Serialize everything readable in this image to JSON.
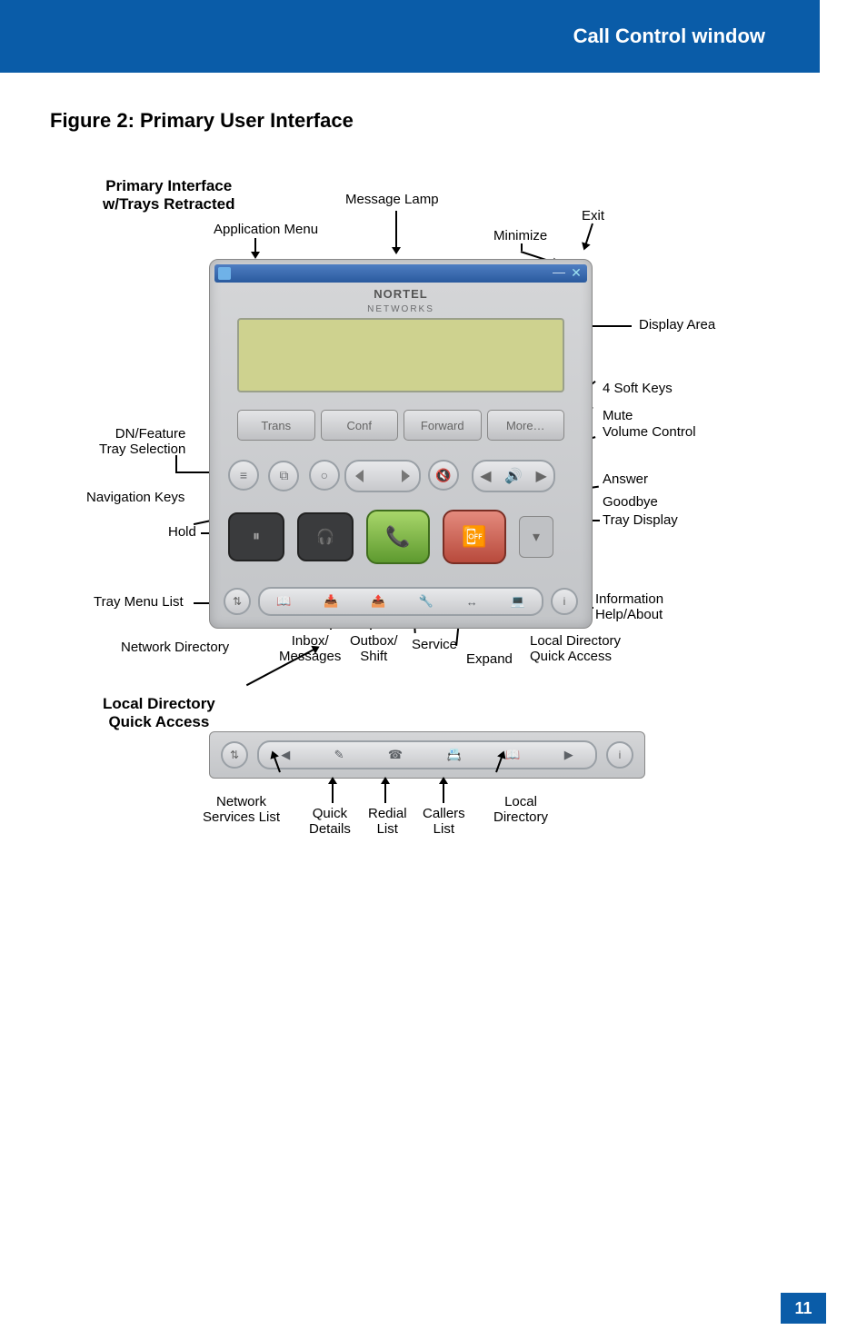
{
  "header": {
    "title": "Call Control window"
  },
  "figure": {
    "caption": "Figure 2: Primary User Interface",
    "page_number": "11"
  },
  "primary": {
    "subtitle_line1": "Primary Interface",
    "subtitle_line2": "w/Trays Retracted",
    "brand_line1": "NORTEL",
    "brand_line2": "NETWORKS",
    "softkeys": [
      "Trans",
      "Conf",
      "Forward",
      "More…"
    ],
    "titlebar_min": "—",
    "titlebar_exit": "✕",
    "callouts": {
      "msg_lamp": "Message Lamp",
      "app_menu": "Application Menu",
      "minimize": "Minimize",
      "exit": "Exit",
      "display_area": "Display Area",
      "four_soft": "4 Soft Keys",
      "mute": "Mute",
      "volume": "Volume Control",
      "dn_feature": "DN/Feature\nTray Selection",
      "nav_keys": "Navigation Keys",
      "answer": "Answer",
      "goodbye": "Goodbye",
      "hold": "Hold",
      "tray_display": "Tray Display",
      "tray_menu": "Tray Menu List",
      "info_help": "Information\nHelp/About",
      "net_dir": "Network Directory",
      "inbox": "Inbox/\nMessages",
      "outbox": "Outbox/\nShift",
      "service": "Service",
      "expand": "Expand",
      "local_dir": "Local Directory\nQuick Access"
    }
  },
  "ldqa": {
    "subtitle_line1": "Local Directory",
    "subtitle_line2": "Quick Access",
    "callouts": {
      "net_services": "Network\nServices List",
      "quick_details": "Quick\nDetails",
      "redial": "Redial\nList",
      "callers": "Callers\nList",
      "local_dir": "Local\nDirectory"
    }
  }
}
